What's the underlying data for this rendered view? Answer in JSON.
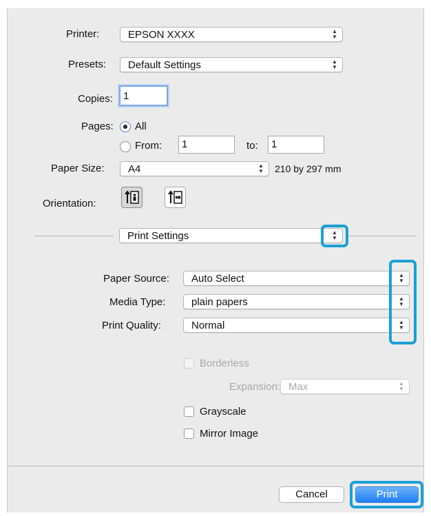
{
  "printer": {
    "label": "Printer:",
    "value": "EPSON XXXX"
  },
  "presets": {
    "label": "Presets:",
    "value": "Default Settings"
  },
  "copies": {
    "label": "Copies:",
    "value": "1"
  },
  "pages": {
    "label": "Pages:",
    "all_label": "All",
    "from_label": "From:",
    "from_value": "1",
    "to_label": "to:",
    "to_value": "1",
    "selected": "All"
  },
  "paper_size": {
    "label": "Paper Size:",
    "value": "A4",
    "dimensions": "210 by 297 mm"
  },
  "orientation": {
    "label": "Orientation:",
    "options": [
      "portrait",
      "landscape"
    ],
    "selected": "portrait"
  },
  "section": {
    "value": "Print Settings"
  },
  "paper_source": {
    "label": "Paper Source:",
    "value": "Auto Select"
  },
  "media_type": {
    "label": "Media Type:",
    "value": "plain papers"
  },
  "print_quality": {
    "label": "Print Quality:",
    "value": "Normal"
  },
  "borderless": {
    "label": "Borderless",
    "checked": false,
    "enabled": false
  },
  "expansion": {
    "label": "Expansion:",
    "value": "Max",
    "enabled": false
  },
  "grayscale": {
    "label": "Grayscale",
    "checked": false
  },
  "mirror_image": {
    "label": "Mirror Image",
    "checked": false
  },
  "buttons": {
    "cancel": "Cancel",
    "print": "Print"
  },
  "colors": {
    "highlight": "#19a0d6",
    "default_button": "#1d7ef2",
    "dialog_bg": "#ebebeb"
  }
}
